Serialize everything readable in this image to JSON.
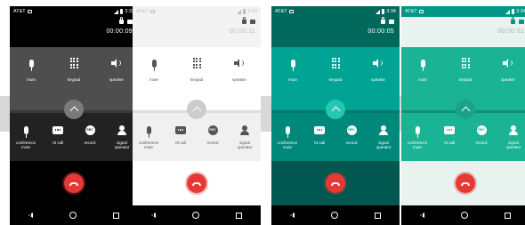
{
  "screens": [
    {
      "carrier": "AT&T",
      "clock": "3:33",
      "timer": "00:00:09",
      "labels": {
        "mute": "mute",
        "keypad": "keypad",
        "speaker": "speaker",
        "conference": "conference\nmute",
        "rtt": "rtt call",
        "record": "record",
        "operator": "signal\noperator",
        "rec_icon": "REC"
      },
      "colors": {
        "status": "#000000",
        "header": "#000000",
        "top": "#4e4e4e",
        "divider": "#3a3a3a",
        "chevron": "#7a7a7a",
        "bottom": "#222222",
        "end": "#000000",
        "nav": "#000000",
        "text": "#ffffff",
        "icon": "#ffffff",
        "navicon": "#ffffff"
      }
    },
    {
      "carrier": "AT&T",
      "clock": "3:33",
      "timer": "00:00:11",
      "labels": {
        "mute": "mute",
        "keypad": "keypad",
        "speaker": "speaker",
        "conference": "conference\nmute",
        "rtt": "rtt call",
        "record": "record",
        "operator": "signal\noperator",
        "rec_icon": "REC"
      },
      "colors": {
        "status": "#f3f3f3",
        "header": "#f3f3f3",
        "top": "#ffffff",
        "divider": "#dddddd",
        "chevron": "#cccccc",
        "bottom": "#f0f0f0",
        "end": "#ffffff",
        "nav": "#000000",
        "text": "#555555",
        "icon": "#555555",
        "navicon": "#ffffff",
        "statustext": "#bbbbbb"
      }
    },
    {
      "carrier": "AT&T",
      "clock": "3:34",
      "timer": "00:00:05",
      "labels": {
        "mute": "mute",
        "keypad": "keypad",
        "speaker": "speaker",
        "conference": "conference\nmute",
        "rtt": "rtt call",
        "record": "record",
        "operator": "signal\noperator",
        "rec_icon": "REC"
      },
      "colors": {
        "status": "#00695c",
        "header": "#00695c",
        "top": "#00a394",
        "divider": "#00796b",
        "chevron": "#26c6b4",
        "bottom": "#00897b",
        "end": "#00574f",
        "nav": "#000000",
        "text": "#ffffff",
        "icon": "#ffffff",
        "navicon": "#ffffff"
      }
    },
    {
      "carrier": "AT&T",
      "clock": "3:34",
      "timer": "00:00:02",
      "labels": {
        "mute": "mute",
        "keypad": "keypad",
        "speaker": "speaker",
        "conference": "conference\nmute",
        "rtt": "rtt call",
        "record": "record",
        "operator": "signal\noperator",
        "rec_icon": "REC"
      },
      "colors": {
        "status": "#009688",
        "header": "#e8f3f0",
        "top": "#1ab394",
        "divider": "#138f77",
        "chevron": "#1aa388",
        "bottom": "#1ab394",
        "end": "#e8f3f0",
        "nav": "#000000",
        "text": "#ffffff",
        "icon": "#ffffff",
        "navicon": "#ffffff",
        "timertext": "#9fb8b2",
        "hdricon": "#009688"
      }
    }
  ]
}
